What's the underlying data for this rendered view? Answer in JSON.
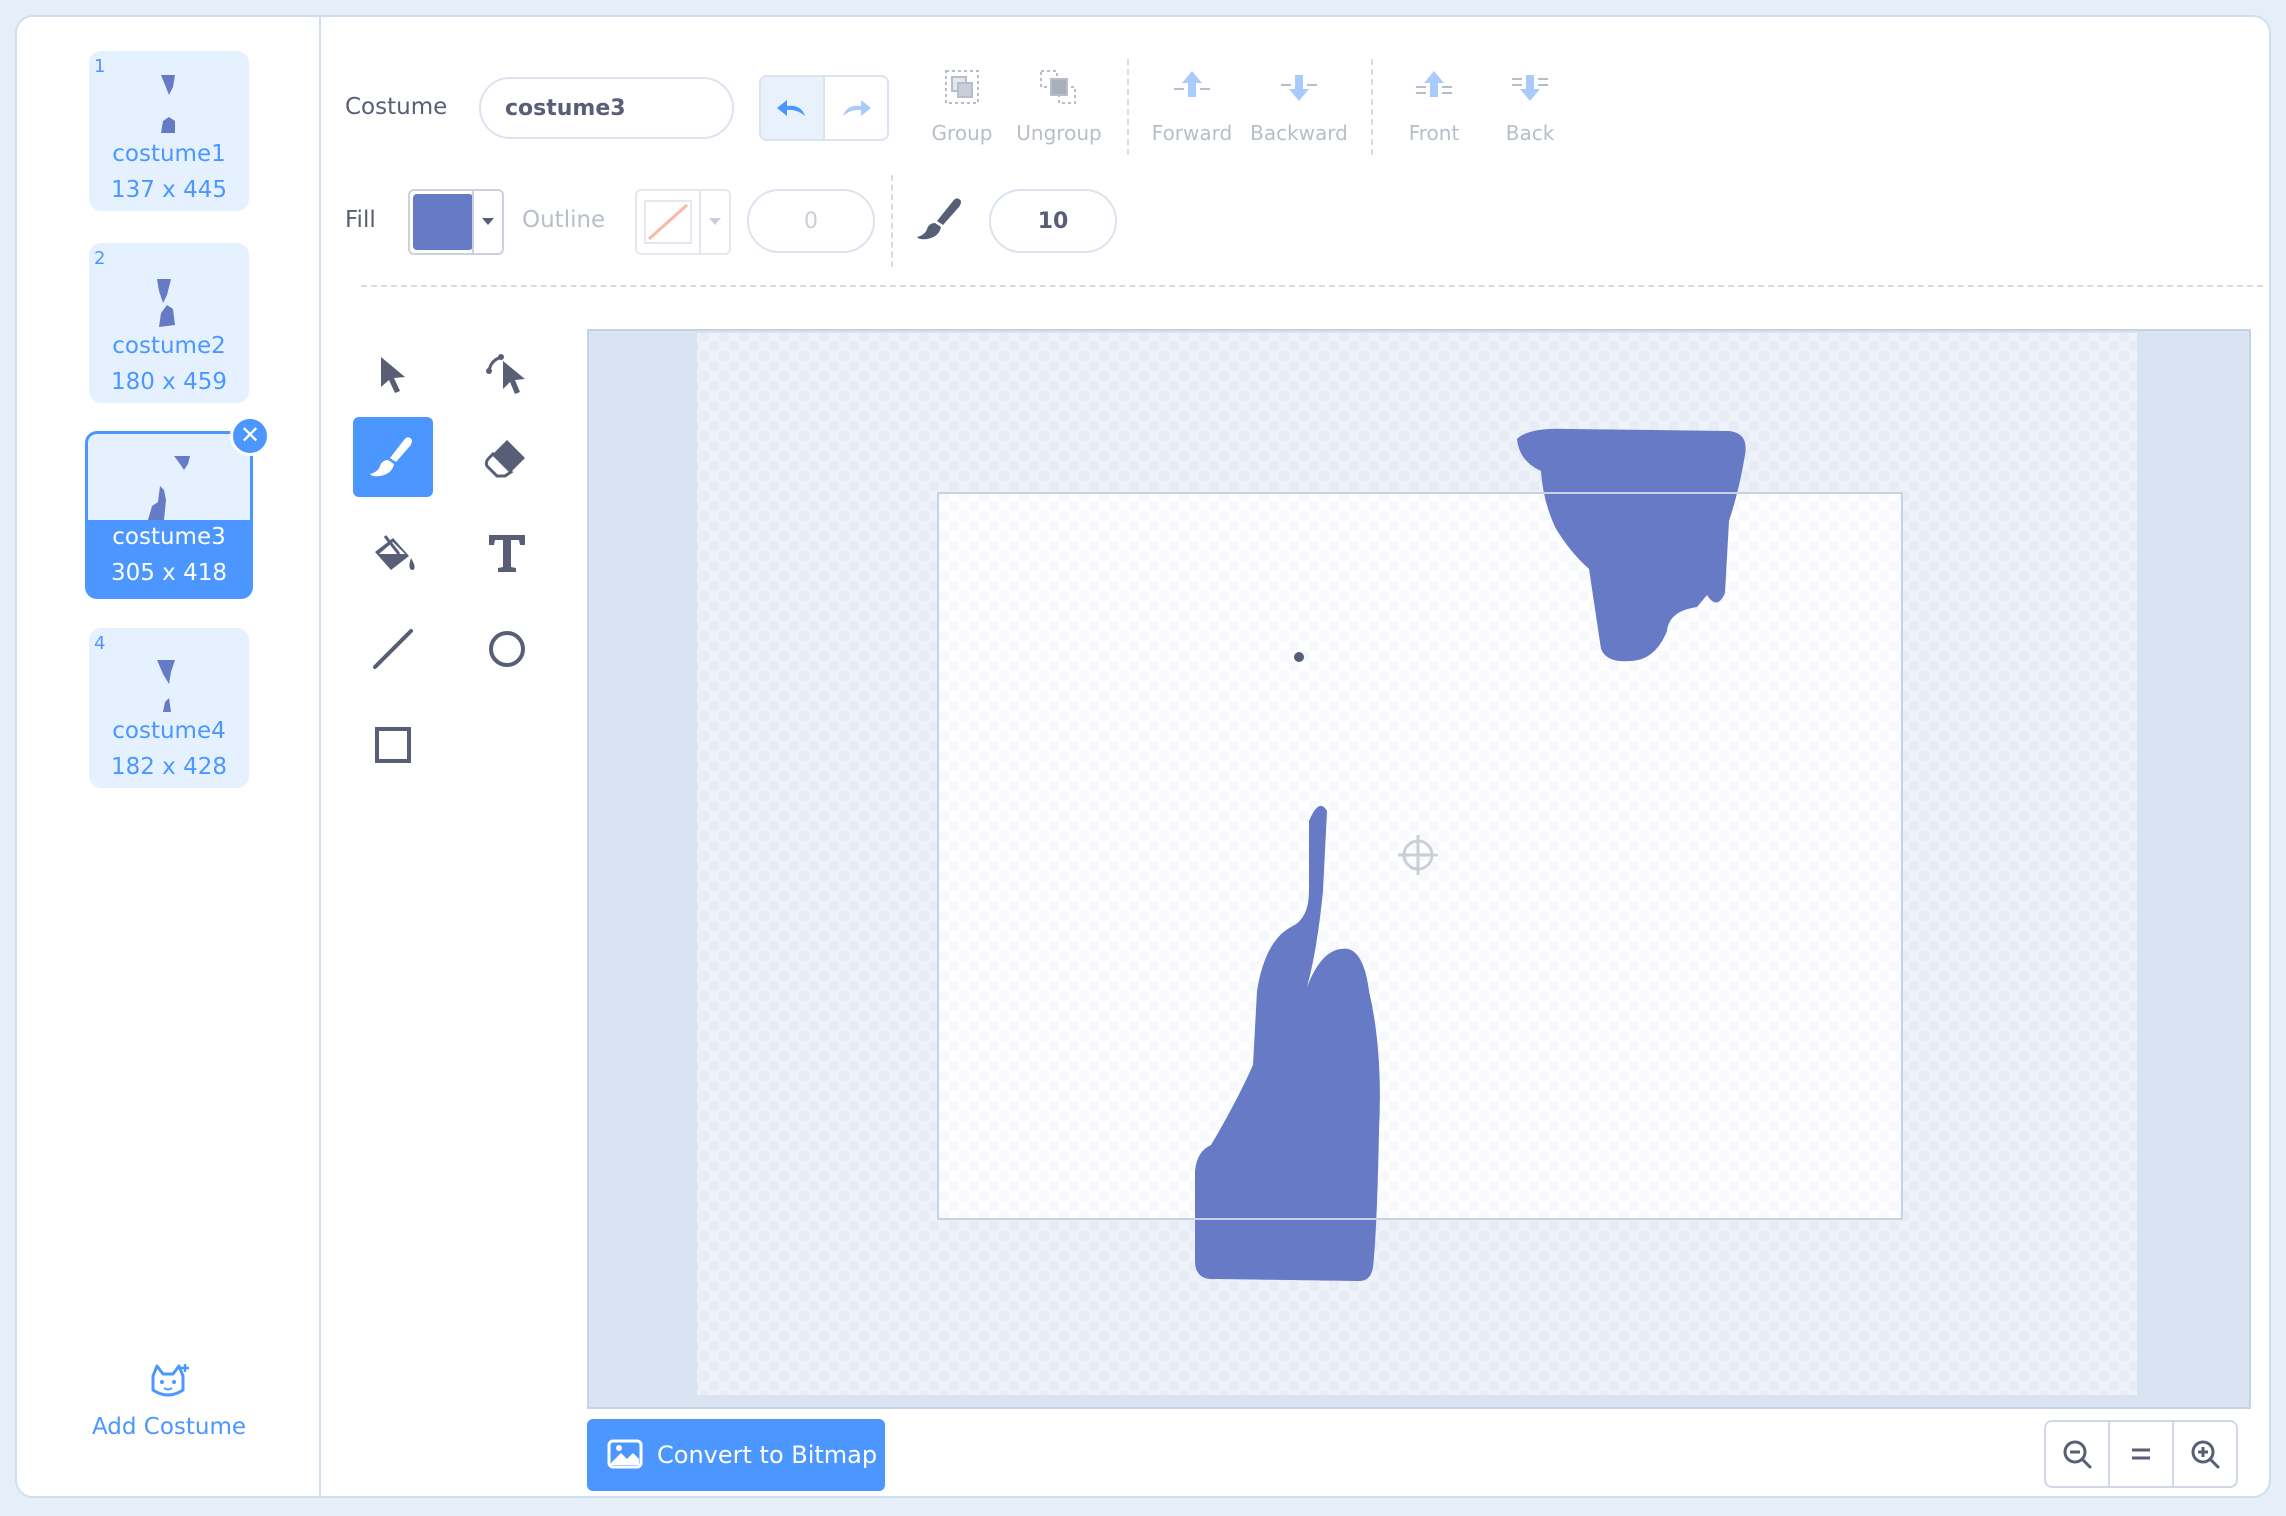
{
  "colors": {
    "accent": "#4c97ff",
    "fill": "#667ac6",
    "text": "#575e75",
    "disabled": "#b8bec9"
  },
  "costumes": [
    {
      "number": "1",
      "name": "costume1",
      "size": "137 x 445"
    },
    {
      "number": "2",
      "name": "costume2",
      "size": "180 x 459"
    },
    {
      "number": "3",
      "name": "costume3",
      "size": "305 x 418",
      "selected": true
    },
    {
      "number": "4",
      "name": "costume4",
      "size": "182 x 428"
    }
  ],
  "add_costume_label": "Add Costume",
  "toolbar": {
    "costume_label": "Costume",
    "costume_name": "costume3",
    "group_label": "Group",
    "ungroup_label": "Ungroup",
    "forward_label": "Forward",
    "backward_label": "Backward",
    "front_label": "Front",
    "back_label": "Back",
    "fill_label": "Fill",
    "outline_label": "Outline",
    "outline_width": "0",
    "brush_size": "10"
  },
  "tools": [
    "select-icon",
    "reshape-icon",
    "brush-icon",
    "eraser-icon",
    "fill-bucket-icon",
    "text-icon",
    "line-icon",
    "circle-icon",
    "rectangle-icon"
  ],
  "active_tool": "brush",
  "convert_label": "Convert to Bitmap"
}
